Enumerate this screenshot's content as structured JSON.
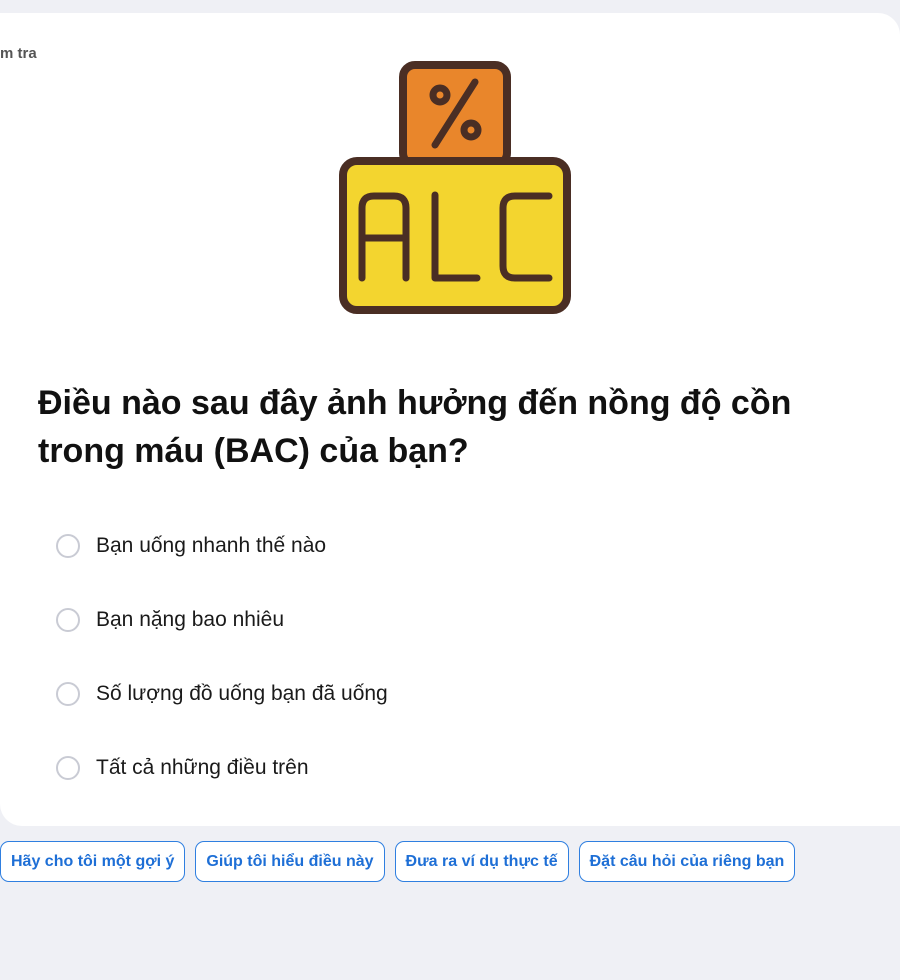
{
  "card": {
    "label_fragment": "m tra",
    "hero_icon": "alc-percent-icon",
    "hero": {
      "top_symbol": "%",
      "label": "ALC",
      "colors": {
        "outline": "#4a2e24",
        "top_fill": "#e9862b",
        "body_fill": "#f3d52f"
      }
    },
    "question": "Điều nào sau đây ảnh hưởng đến nồng độ cồn trong máu (BAC) của bạn?",
    "options": [
      {
        "label": "Bạn uống nhanh thế nào"
      },
      {
        "label": "Bạn nặng bao nhiêu"
      },
      {
        "label": "Số lượng đồ uống bạn đã uống"
      },
      {
        "label": "Tất cả những điều trên"
      }
    ]
  },
  "chips": [
    {
      "label": "Hãy cho tôi một gợi ý"
    },
    {
      "label": "Giúp tôi hiểu điều này"
    },
    {
      "label": "Đưa ra ví dụ thực tế"
    },
    {
      "label": "Đặt câu hỏi của riêng bạn"
    }
  ],
  "colors": {
    "page_bg": "#eff0f5",
    "accent": "#1e6fd6"
  }
}
